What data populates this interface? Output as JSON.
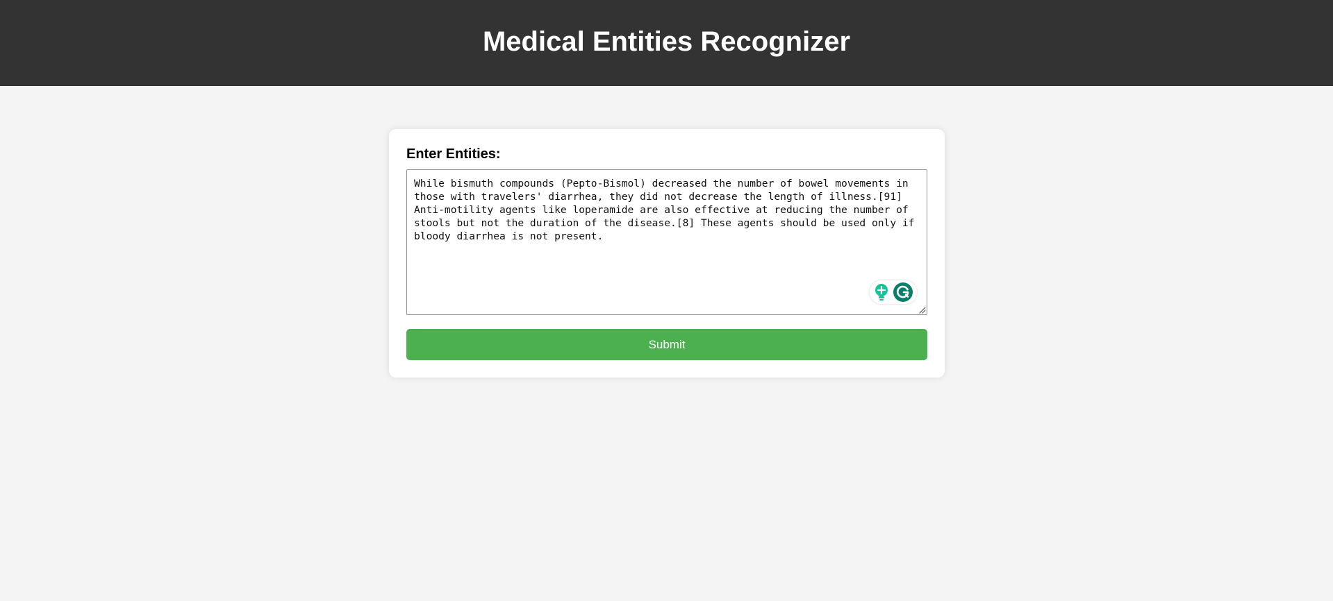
{
  "header": {
    "title": "Medical Entities Recognizer"
  },
  "form": {
    "label": "Enter Entities:",
    "textarea_value": "While bismuth compounds (Pepto-Bismol) decreased the number of bowel movements in those with travelers' diarrhea, they did not decrease the length of illness.[91] Anti-motility agents like loperamide are also effective at reducing the number of stools but not the duration of the disease.[8] These agents should be used only if bloody diarrhea is not present.",
    "submit_label": "Submit"
  },
  "icons": {
    "grammarly_suggestions": "lightbulb-icon",
    "grammarly_logo": "grammarly-icon",
    "resize": "resize-handle-icon"
  },
  "colors": {
    "header_bg": "#333333",
    "page_bg": "#f4f4f4",
    "submit_bg": "#4caf50",
    "grammarly_green": "#15c39a",
    "grammarly_dark": "#0b7d6b"
  }
}
